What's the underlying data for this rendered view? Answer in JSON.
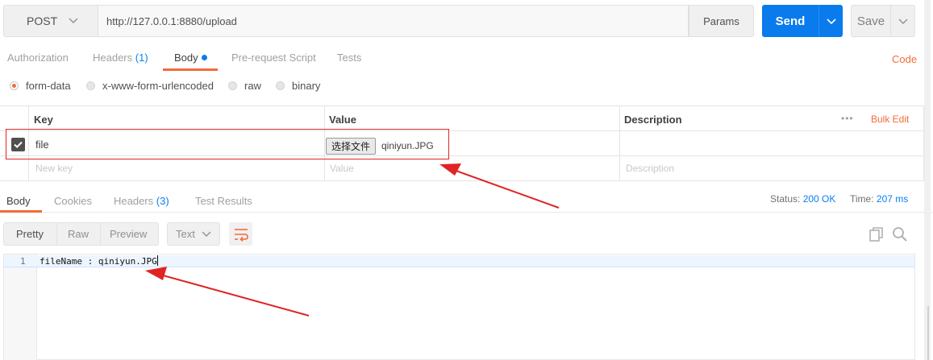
{
  "request": {
    "method": "POST",
    "url": "http://127.0.0.1:8880/upload",
    "params_label": "Params",
    "send_label": "Send",
    "save_label": "Save"
  },
  "request_tabs": {
    "authorization": "Authorization",
    "headers": "Headers",
    "headers_count": "(1)",
    "body": "Body",
    "prerequest": "Pre-request Script",
    "tests": "Tests",
    "code": "Code"
  },
  "body_types": {
    "form_data": "form-data",
    "urlencoded": "x-www-form-urlencoded",
    "raw": "raw",
    "binary": "binary",
    "selected": "form-data"
  },
  "kv_table": {
    "headers": {
      "key": "Key",
      "value": "Value",
      "description": "Description",
      "bulk_edit": "Bulk Edit",
      "more": "•••"
    },
    "rows": [
      {
        "checked": true,
        "key": "file",
        "file_button": "选择文件",
        "file_name": "qiniyun.JPG",
        "description": ""
      }
    ],
    "placeholders": {
      "key": "New key",
      "value": "Value",
      "description": "Description"
    }
  },
  "response_tabs": {
    "body": "Body",
    "cookies": "Cookies",
    "headers": "Headers",
    "headers_count": "(3)",
    "test_results": "Test Results",
    "status_label": "Status:",
    "status_value": "200 OK",
    "time_label": "Time:",
    "time_value": "207 ms"
  },
  "response_toolbar": {
    "pretty": "Pretty",
    "raw": "Raw",
    "preview": "Preview",
    "format": "Text"
  },
  "response_body": {
    "line_number": "1",
    "line_text": "fileName : qiniyun.JPG"
  },
  "colors": {
    "accent": "#f26b3a",
    "send": "#097bed",
    "link": "#0a7ff2",
    "annotation": "#e02424"
  }
}
